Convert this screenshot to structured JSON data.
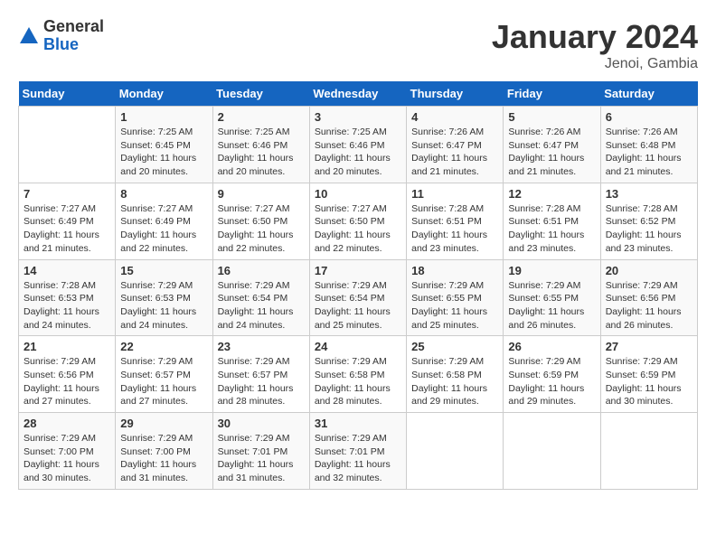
{
  "header": {
    "logo_general": "General",
    "logo_blue": "Blue",
    "month_title": "January 2024",
    "location": "Jenoi, Gambia"
  },
  "weekdays": [
    "Sunday",
    "Monday",
    "Tuesday",
    "Wednesday",
    "Thursday",
    "Friday",
    "Saturday"
  ],
  "weeks": [
    [
      {
        "day": "",
        "info": ""
      },
      {
        "day": "1",
        "info": "Sunrise: 7:25 AM\nSunset: 6:45 PM\nDaylight: 11 hours\nand 20 minutes."
      },
      {
        "day": "2",
        "info": "Sunrise: 7:25 AM\nSunset: 6:46 PM\nDaylight: 11 hours\nand 20 minutes."
      },
      {
        "day": "3",
        "info": "Sunrise: 7:25 AM\nSunset: 6:46 PM\nDaylight: 11 hours\nand 20 minutes."
      },
      {
        "day": "4",
        "info": "Sunrise: 7:26 AM\nSunset: 6:47 PM\nDaylight: 11 hours\nand 21 minutes."
      },
      {
        "day": "5",
        "info": "Sunrise: 7:26 AM\nSunset: 6:47 PM\nDaylight: 11 hours\nand 21 minutes."
      },
      {
        "day": "6",
        "info": "Sunrise: 7:26 AM\nSunset: 6:48 PM\nDaylight: 11 hours\nand 21 minutes."
      }
    ],
    [
      {
        "day": "7",
        "info": "Sunrise: 7:27 AM\nSunset: 6:49 PM\nDaylight: 11 hours\nand 21 minutes."
      },
      {
        "day": "8",
        "info": "Sunrise: 7:27 AM\nSunset: 6:49 PM\nDaylight: 11 hours\nand 22 minutes."
      },
      {
        "day": "9",
        "info": "Sunrise: 7:27 AM\nSunset: 6:50 PM\nDaylight: 11 hours\nand 22 minutes."
      },
      {
        "day": "10",
        "info": "Sunrise: 7:27 AM\nSunset: 6:50 PM\nDaylight: 11 hours\nand 22 minutes."
      },
      {
        "day": "11",
        "info": "Sunrise: 7:28 AM\nSunset: 6:51 PM\nDaylight: 11 hours\nand 23 minutes."
      },
      {
        "day": "12",
        "info": "Sunrise: 7:28 AM\nSunset: 6:51 PM\nDaylight: 11 hours\nand 23 minutes."
      },
      {
        "day": "13",
        "info": "Sunrise: 7:28 AM\nSunset: 6:52 PM\nDaylight: 11 hours\nand 23 minutes."
      }
    ],
    [
      {
        "day": "14",
        "info": "Sunrise: 7:28 AM\nSunset: 6:53 PM\nDaylight: 11 hours\nand 24 minutes."
      },
      {
        "day": "15",
        "info": "Sunrise: 7:29 AM\nSunset: 6:53 PM\nDaylight: 11 hours\nand 24 minutes."
      },
      {
        "day": "16",
        "info": "Sunrise: 7:29 AM\nSunset: 6:54 PM\nDaylight: 11 hours\nand 24 minutes."
      },
      {
        "day": "17",
        "info": "Sunrise: 7:29 AM\nSunset: 6:54 PM\nDaylight: 11 hours\nand 25 minutes."
      },
      {
        "day": "18",
        "info": "Sunrise: 7:29 AM\nSunset: 6:55 PM\nDaylight: 11 hours\nand 25 minutes."
      },
      {
        "day": "19",
        "info": "Sunrise: 7:29 AM\nSunset: 6:55 PM\nDaylight: 11 hours\nand 26 minutes."
      },
      {
        "day": "20",
        "info": "Sunrise: 7:29 AM\nSunset: 6:56 PM\nDaylight: 11 hours\nand 26 minutes."
      }
    ],
    [
      {
        "day": "21",
        "info": "Sunrise: 7:29 AM\nSunset: 6:56 PM\nDaylight: 11 hours\nand 27 minutes."
      },
      {
        "day": "22",
        "info": "Sunrise: 7:29 AM\nSunset: 6:57 PM\nDaylight: 11 hours\nand 27 minutes."
      },
      {
        "day": "23",
        "info": "Sunrise: 7:29 AM\nSunset: 6:57 PM\nDaylight: 11 hours\nand 28 minutes."
      },
      {
        "day": "24",
        "info": "Sunrise: 7:29 AM\nSunset: 6:58 PM\nDaylight: 11 hours\nand 28 minutes."
      },
      {
        "day": "25",
        "info": "Sunrise: 7:29 AM\nSunset: 6:58 PM\nDaylight: 11 hours\nand 29 minutes."
      },
      {
        "day": "26",
        "info": "Sunrise: 7:29 AM\nSunset: 6:59 PM\nDaylight: 11 hours\nand 29 minutes."
      },
      {
        "day": "27",
        "info": "Sunrise: 7:29 AM\nSunset: 6:59 PM\nDaylight: 11 hours\nand 30 minutes."
      }
    ],
    [
      {
        "day": "28",
        "info": "Sunrise: 7:29 AM\nSunset: 7:00 PM\nDaylight: 11 hours\nand 30 minutes."
      },
      {
        "day": "29",
        "info": "Sunrise: 7:29 AM\nSunset: 7:00 PM\nDaylight: 11 hours\nand 31 minutes."
      },
      {
        "day": "30",
        "info": "Sunrise: 7:29 AM\nSunset: 7:01 PM\nDaylight: 11 hours\nand 31 minutes."
      },
      {
        "day": "31",
        "info": "Sunrise: 7:29 AM\nSunset: 7:01 PM\nDaylight: 11 hours\nand 32 minutes."
      },
      {
        "day": "",
        "info": ""
      },
      {
        "day": "",
        "info": ""
      },
      {
        "day": "",
        "info": ""
      }
    ]
  ]
}
